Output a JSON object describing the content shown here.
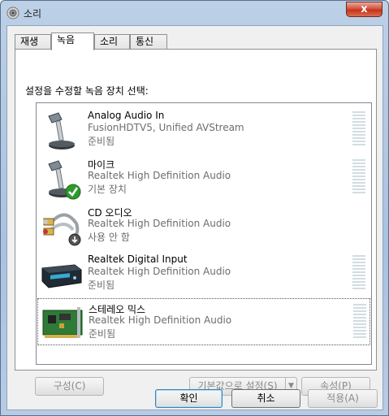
{
  "window": {
    "title": "소리",
    "close_label": "x"
  },
  "tabs": [
    {
      "label": "재생"
    },
    {
      "label": "녹음"
    },
    {
      "label": "소리"
    },
    {
      "label": "통신"
    }
  ],
  "instruction": "설정을 수정할 녹음 장치 선택:",
  "devices": [
    {
      "name": "Analog Audio In",
      "description": "FusionHDTV5, Unified AVStream",
      "status": "준비됨",
      "icon": "microphone-icon"
    },
    {
      "name": "마이크",
      "description": "Realtek High Definition Audio",
      "status": "기본 장치",
      "icon": "microphone-default-icon"
    },
    {
      "name": "CD 오디오",
      "description": "Realtek High Definition Audio",
      "status": "사용 안 함",
      "icon": "rca-cable-disabled-icon"
    },
    {
      "name": "Realtek Digital Input",
      "description": "Realtek High Definition Audio",
      "status": "준비됨",
      "icon": "digital-input-box-icon"
    },
    {
      "name": "스테레오 믹스",
      "description": "Realtek High Definition Audio",
      "status": "준비됨",
      "icon": "sound-card-icon"
    }
  ],
  "buttons": {
    "configure": "구성(C)",
    "set_default": "기본값으로 설정(S)",
    "properties": "속성(P)",
    "ok": "확인",
    "cancel": "취소",
    "apply": "적용(A)"
  },
  "colors": {
    "accent": "#3c7fb1",
    "meter": "#d2dde1",
    "status_ok": "#2e9a2e"
  }
}
